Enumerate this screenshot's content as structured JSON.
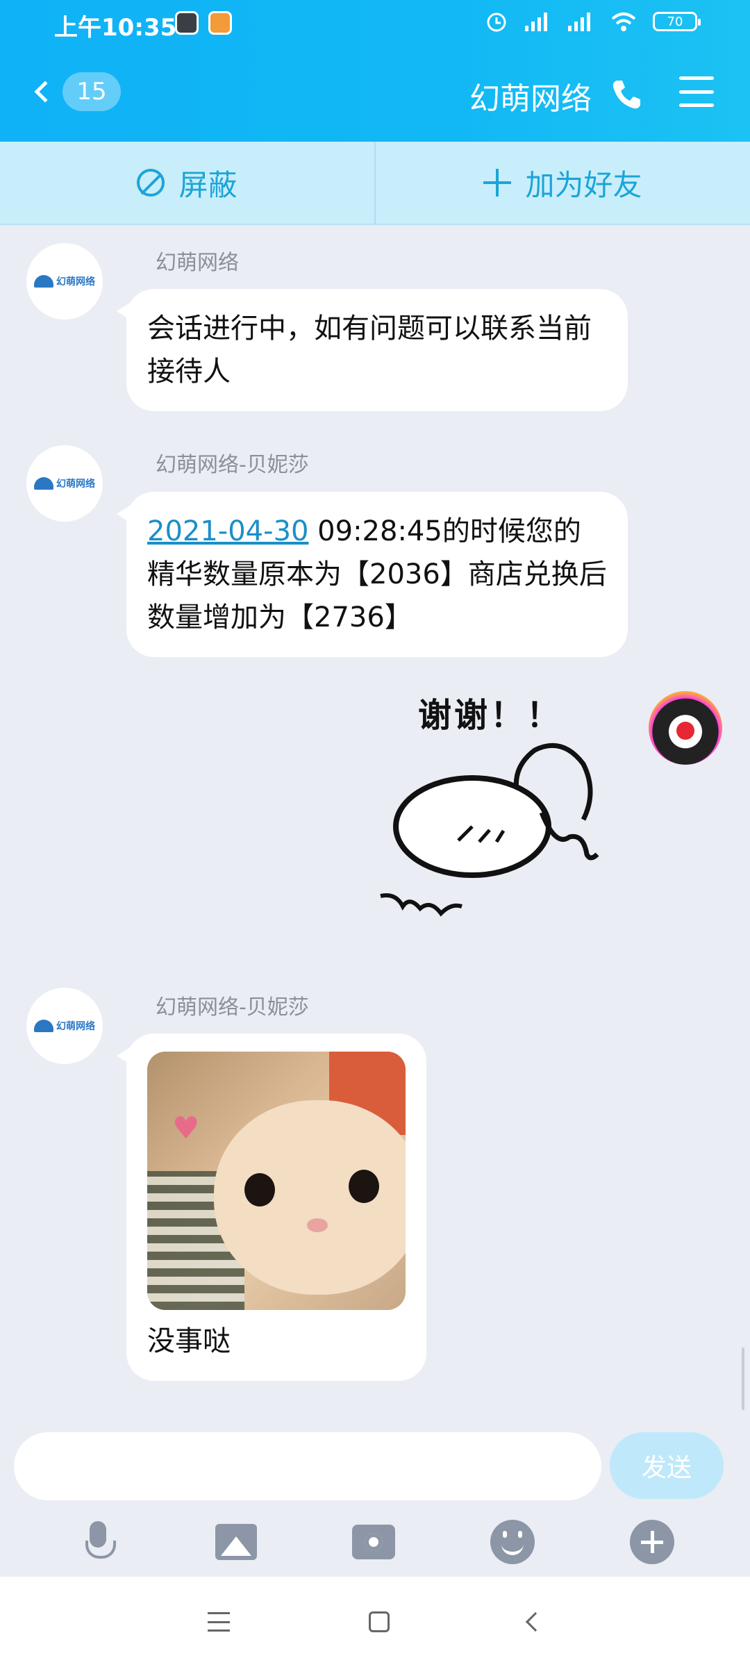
{
  "status_bar": {
    "time": "上午10:35",
    "battery": "70"
  },
  "nav": {
    "back_badge": "15",
    "title": "幻萌网络"
  },
  "actions": {
    "block_label": "屏蔽",
    "add_friend_label": "加为好友"
  },
  "messages": [
    {
      "sender": "幻萌网络",
      "text": "会话进行中，如有问题可以联系当前接待人"
    },
    {
      "sender": "幻萌网络-贝妮莎",
      "date_link": "2021-04-30",
      "text_after_link": " 09:28:45的时候您的精华数量原本为【2036】商店兑换后数量增加为【2736】"
    },
    {
      "sender": "me",
      "sticker_text": "谢谢！！"
    },
    {
      "sender": "幻萌网络-贝妮莎",
      "caption": "没事哒"
    }
  ],
  "avatar_logo_text": "幻萌网络",
  "input": {
    "placeholder": "",
    "send_label": "发送"
  },
  "colors": {
    "header": "#12b8f4",
    "action_bar": "#c9eefb",
    "accent": "#1ca5d8",
    "chat_bg": "#eaedf4"
  },
  "icons": [
    "back-chevron-icon",
    "phone-icon",
    "menu-icon",
    "block-icon",
    "plus-icon",
    "mic-icon",
    "image-icon",
    "camera-icon",
    "emoji-icon",
    "more-icon"
  ]
}
